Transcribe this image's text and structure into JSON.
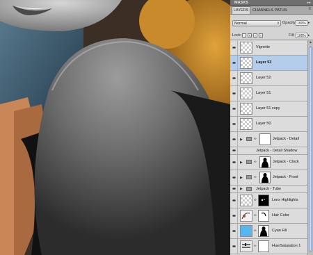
{
  "panel": {
    "masks_label": "MASKS",
    "tabs": [
      {
        "label": "LAYERS",
        "active": true
      },
      {
        "label": "CHANNELS",
        "active": false
      },
      {
        "label": "PATHS",
        "active": false
      }
    ],
    "blend_mode": "Normal",
    "opacity_label": "Opacity:",
    "opacity_value": "100%",
    "lock_label": "Lock:",
    "fill_label": "Fill:",
    "fill_value": "100%"
  },
  "layers": [
    {
      "name": "Vignette",
      "kind": "layer",
      "selected": false
    },
    {
      "name": "Layer 53",
      "kind": "layer",
      "selected": true
    },
    {
      "name": "Layer 52",
      "kind": "layer",
      "selected": false
    },
    {
      "name": "Layer 51",
      "kind": "layer",
      "selected": false
    },
    {
      "name": "Layer 51 copy",
      "kind": "layer",
      "selected": false
    },
    {
      "name": "Layer 50",
      "kind": "layer",
      "selected": false
    },
    {
      "name": "Jetpack - Detail",
      "kind": "group-mask-white",
      "selected": false
    },
    {
      "name": "Jetpack - Detail Shadow",
      "kind": "group-small",
      "selected": false
    },
    {
      "name": "Jetpack - Clock",
      "kind": "group-mask-silhouette",
      "selected": false
    },
    {
      "name": "Jetpack - Front",
      "kind": "group-mask-silhouette",
      "selected": false
    },
    {
      "name": "Jetpack - Tube",
      "kind": "group-small",
      "selected": false
    },
    {
      "name": "Lens Highlights",
      "kind": "layer-mask-dots",
      "selected": false
    },
    {
      "name": "Hair Color",
      "kind": "adjust-mask-hair",
      "selected": false
    },
    {
      "name": "Cyan Fill",
      "kind": "fill-mask-silhouette",
      "selected": false
    },
    {
      "name": "Hue/Saturation 1",
      "kind": "adjust-mask-white",
      "selected": false
    }
  ],
  "colors": {
    "selection": "#b3cdea",
    "cyan_fill": "#56b8ef"
  }
}
